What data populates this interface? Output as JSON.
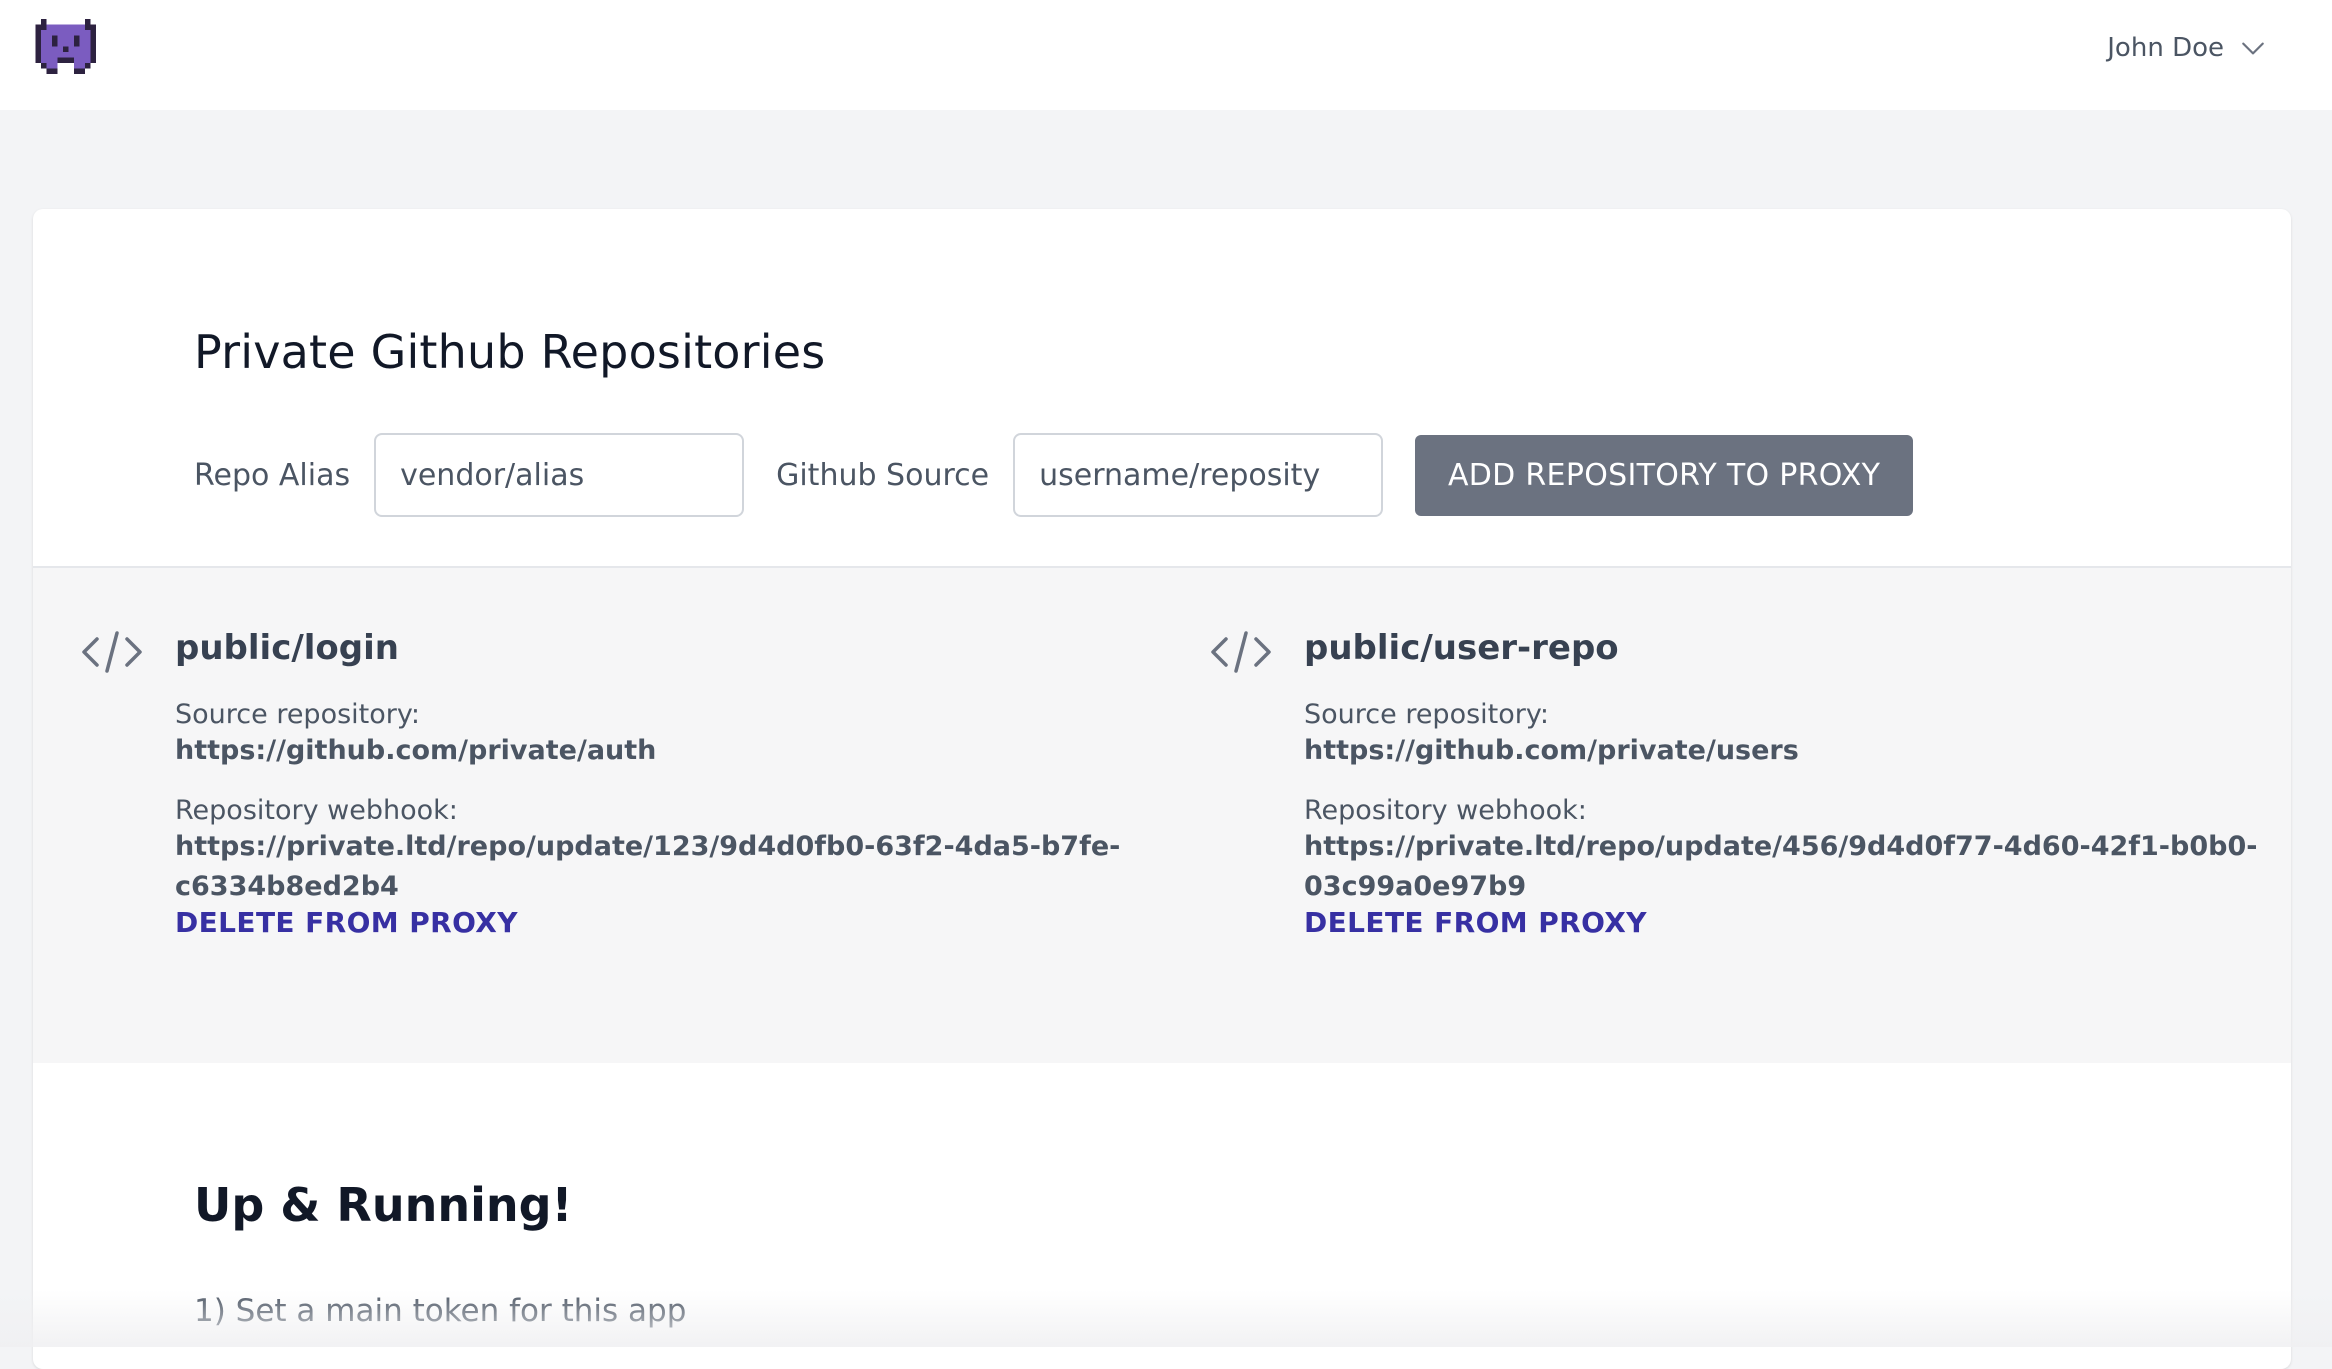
{
  "header": {
    "logo_icon": "pixel-invader-logo",
    "user_name": "John Doe",
    "user_menu_icon": "chevron-down-icon"
  },
  "repositories_panel": {
    "title": "Private Github Repositories",
    "form": {
      "alias_label": "Repo Alias",
      "alias_placeholder": "vendor/alias",
      "source_label": "Github Source",
      "source_placeholder": "username/reposity",
      "add_button": "ADD REPOSITORY TO PROXY"
    },
    "repos": [
      {
        "icon": "code-icon",
        "name": "public/login",
        "source_label": "Source repository:",
        "source_url": "https://github.com/private/auth",
        "webhook_label": "Repository webhook:",
        "webhook_line1": "https://private.ltd/repo/update/123/9d4d0fb0-63f2-4da5-b7fe-",
        "webhook_line2": "c6334b8ed2b4",
        "delete_label": "DELETE FROM PROXY"
      },
      {
        "icon": "code-icon",
        "name": "public/user-repo",
        "source_label": "Source repository:",
        "source_url": "https://github.com/private/users",
        "webhook_label": "Repository webhook:",
        "webhook_line1": "https://private.ltd/repo/update/456/9d4d0f77-4d60-42f1-b0b0-",
        "webhook_line2": "03c99a0e97b9",
        "delete_label": "DELETE FROM PROXY"
      }
    ]
  },
  "running": {
    "title": "Up & Running!",
    "step_1": "1) Set a main token for this app"
  },
  "colors": {
    "page_bg": "#f3f4f6",
    "button_bg": "#6b7280",
    "link": "#3730a3",
    "logo": "#6b4ea0"
  }
}
